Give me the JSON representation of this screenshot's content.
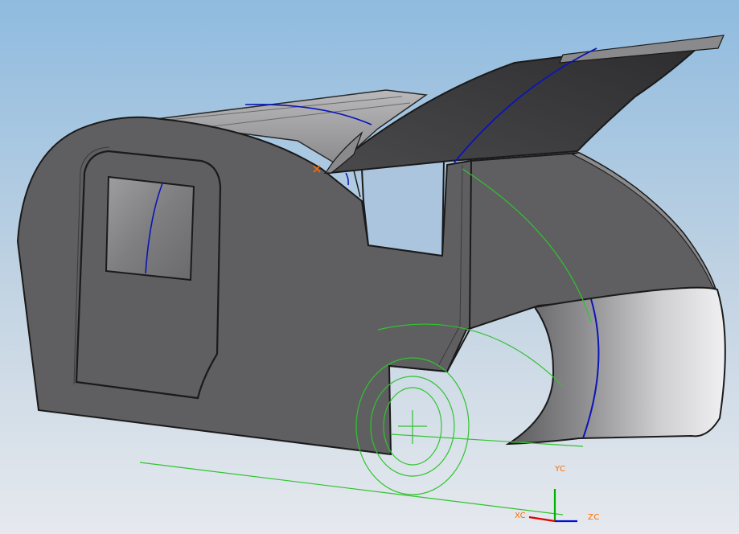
{
  "scene": {
    "background_top": "#8fbbdf",
    "background_bottom": "#e6e9ee",
    "body_color": "#5f5f61",
    "edge_color": "#1a1a1a",
    "hatch_color": "#3b3b3d",
    "curve_blue": "#0a14b8",
    "sketch_green": "#2fc42f",
    "marker_color": "#ff6a00"
  },
  "triad": {
    "yc_label": "YC",
    "xc_label": "XC",
    "zc_label": "ZC",
    "x_color": "#e00000",
    "y_color": "#00b000",
    "z_color": "#0010d0"
  }
}
